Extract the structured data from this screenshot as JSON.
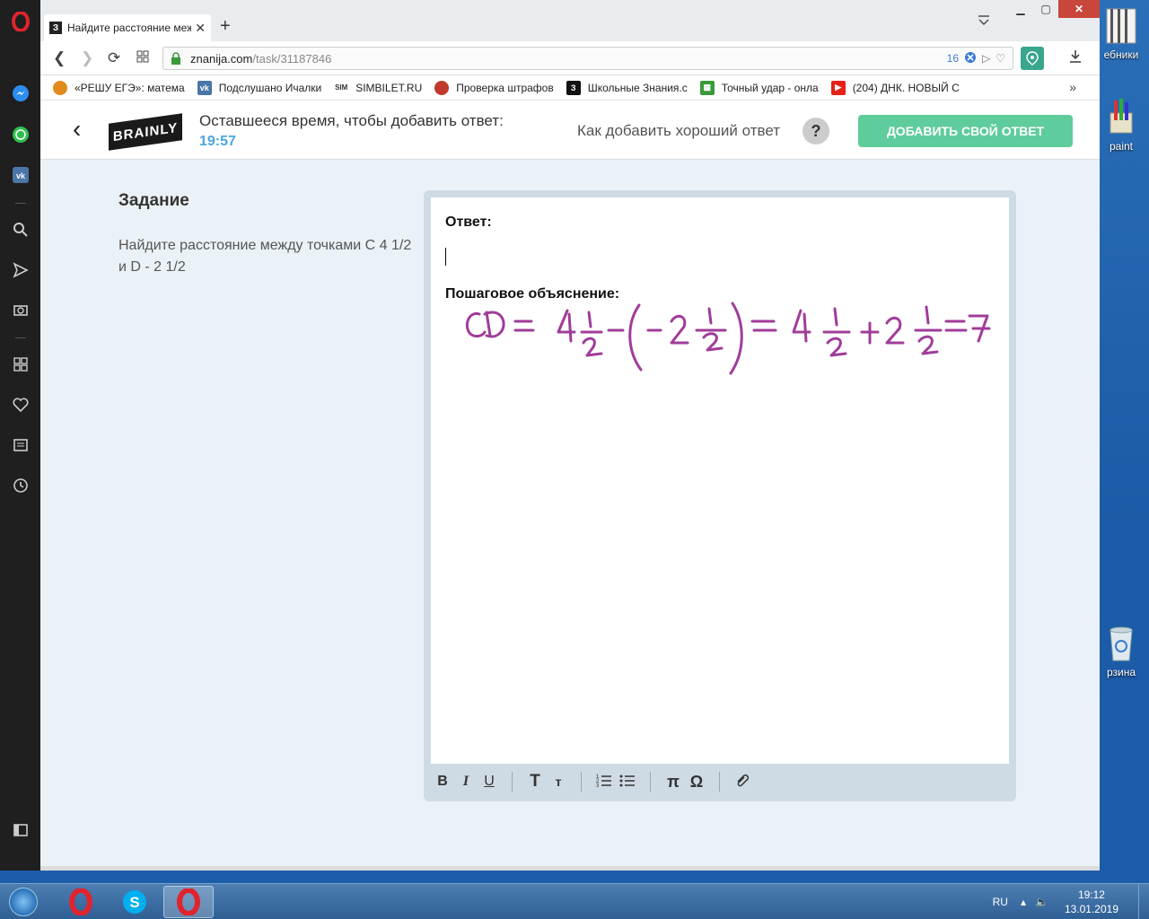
{
  "desktop": {
    "icons": [
      {
        "label": "ебники"
      },
      {
        "label": "paint"
      },
      {
        "label": "рзина"
      }
    ]
  },
  "browser": {
    "tab_title": "Найдите расстояние меж",
    "tab_favicon": "З",
    "url_host": "znanija.com",
    "url_path": "/task/31187846",
    "url_badge": "16",
    "bookmarks": [
      {
        "label": "«РЕШУ ЕГЭ»: матема",
        "icon": "sun-icon",
        "color": "#e08a1e"
      },
      {
        "label": "Подслушано Ичалки",
        "icon": "vk-icon",
        "color": "#4a76a8"
      },
      {
        "label": "SIMBILET.RU",
        "icon": "sim-icon",
        "color": "#333333"
      },
      {
        "label": "Проверка штрафов",
        "icon": "emblem-icon",
        "color": "#c0392b"
      },
      {
        "label": "Школьные Знания.c",
        "icon": "znanija-icon",
        "color": "#111111"
      },
      {
        "label": "Точный удар - онла",
        "icon": "grid-icon",
        "color": "#3a9a3a"
      },
      {
        "label": "(204) ДНК. НОВЫЙ С",
        "icon": "youtube-icon",
        "color": "#e62117"
      }
    ]
  },
  "page": {
    "timer_label": "Оставшееся время, чтобы добавить ответ:",
    "timer_value": "19:57",
    "howto_label": "Как добавить хороший ответ",
    "help_symbol": "?",
    "add_answer_label": "ДОБАВИТЬ СВОЙ ОТВЕТ",
    "logo_text": "BRAINLY",
    "task_title": "Задание",
    "task_text": "Найдите расстояние между точками С 4 1/2 и D - 2 1/2",
    "answer_label": "Ответ:",
    "explanation_label": "Пошаговое объяснение:",
    "toolbar": {
      "bold": "B",
      "italic": "I",
      "underline": "U",
      "heading_large": "T",
      "heading_small": "т",
      "ordered_list": "☰",
      "bullet_list": "☰",
      "pi": "π",
      "omega": "Ω",
      "attach": "⌀"
    },
    "accent_color": "#5fcc9c",
    "timer_color": "#4ba8e0",
    "handwriting_color": "#a03c9a"
  },
  "taskbar": {
    "language": "RU",
    "time": "19:12",
    "date": "13.01.2019"
  }
}
